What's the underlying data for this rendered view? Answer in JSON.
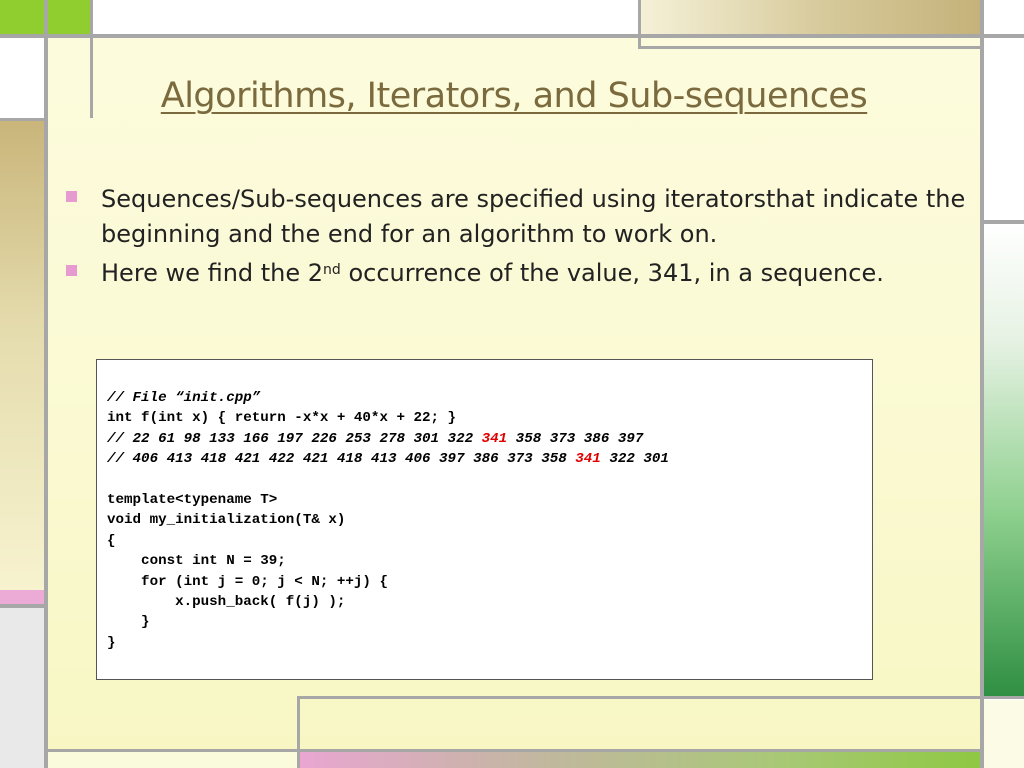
{
  "title": "Algorithms, Iterators, and Sub-sequences",
  "bullets": [
    {
      "text": "Sequences/Sub-sequences are specified using iteratorsthat indicate the beginning and the end for an algorithm to work on."
    },
    {
      "text_before": "Here we find the 2",
      "superscript": "nd",
      "text_after": " occurrence of the value, 341, in a sequence."
    }
  ],
  "code": {
    "comment_file": "// File “init.cpp”",
    "func_def": "int f(int x) { return -x*x + 40*x + 22; }",
    "seq1_before": "// 22 61 98 133 166 197 226 253 278 301 322 ",
    "seq1_highlight": "341",
    "seq1_after": " 358 373 386 397",
    "seq2_before": "// 406 413 418 421 422 421 418 413 406 397 386 373 358 ",
    "seq2_highlight": "341",
    "seq2_after": " 322 301",
    "template_line": "template<typename T>",
    "void_line": "void my_initialization(T& x)",
    "open_brace": "{",
    "const_line": "    const int N = 39;",
    "for_line": "    for (int j = 0; j < N; ++j) {",
    "push_line": "        x.push_back( f(j) );",
    "inner_close": "    }",
    "close_brace": "}"
  },
  "colors": {
    "title": "#7a6a3d",
    "highlight": "#e00000",
    "bullet_marker": "#e69ad0"
  }
}
